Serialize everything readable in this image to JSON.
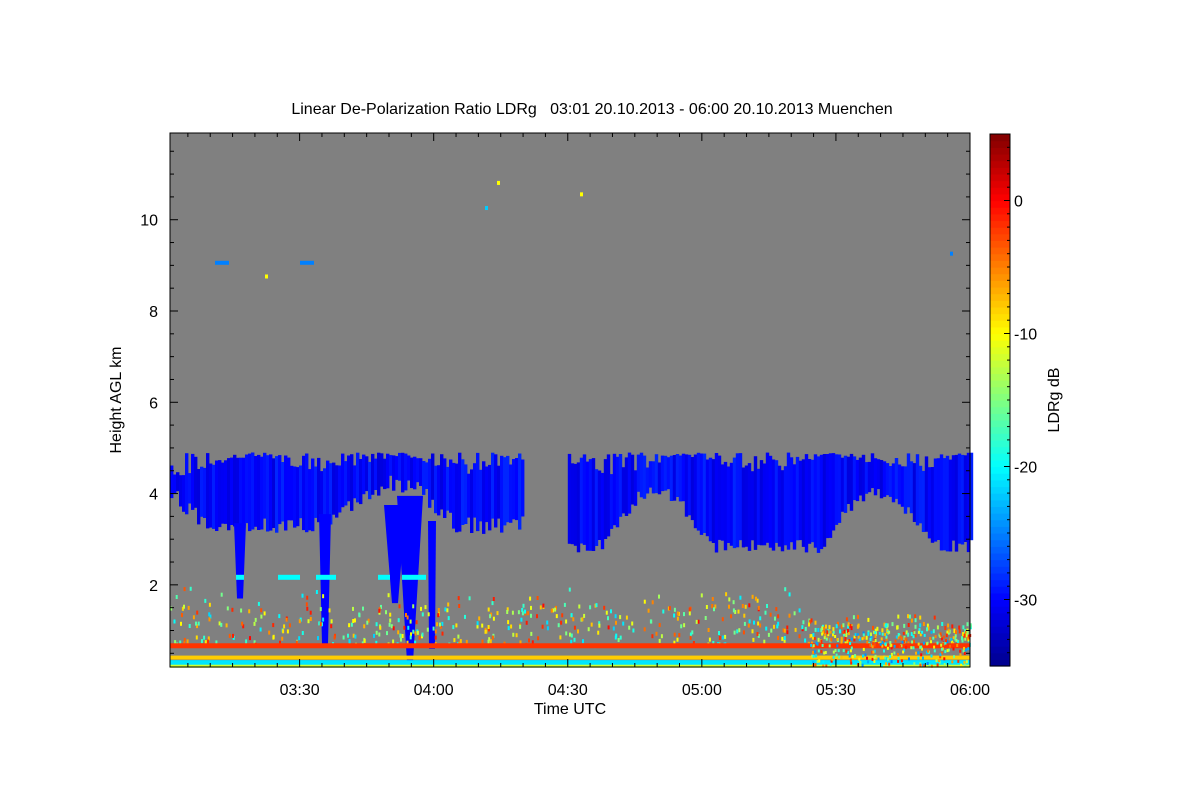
{
  "chart_data": {
    "type": "heatmap",
    "title": "Linear De-Polarization Ratio LDRg   03:01 20.10.2013 - 06:00 20.10.2013 Muenchen",
    "xlabel": "Time UTC",
    "ylabel": "Height AGL km",
    "x_range": [
      "03:01",
      "06:00"
    ],
    "x_ticks": [
      "03:30",
      "04:00",
      "04:30",
      "05:00",
      "05:30",
      "06:00"
    ],
    "y_range": [
      0.2,
      11.9
    ],
    "y_ticks": [
      2,
      4,
      6,
      8,
      10
    ],
    "colorbar": {
      "label": "LDRg dB",
      "range": [
        -35,
        5
      ],
      "ticks": [
        0,
        -10,
        -20,
        -30
      ],
      "colormap": "jet",
      "colors": [
        "#00008b",
        "#0000ff",
        "#0080ff",
        "#00ffff",
        "#80ff80",
        "#ffff00",
        "#ff8000",
        "#ff0000",
        "#800000"
      ]
    },
    "background_color": "#808080",
    "features": [
      {
        "name": "cloud layer",
        "time_start": "03:01",
        "time_end": "04:20",
        "base_km": 3.1,
        "top_km": 5.0,
        "ldr_db": -30
      },
      {
        "name": "cloud layer",
        "time_start": "04:30",
        "time_end": "06:00",
        "base_km": 2.7,
        "top_km": 5.0,
        "ldr_db": -30
      },
      {
        "name": "fall streaks",
        "time_start": "03:20",
        "time_end": "04:00",
        "base_km": 0.2,
        "top_km": 3.0,
        "ldr_db": -30
      },
      {
        "name": "near-surface layer",
        "time_start": "03:01",
        "time_end": "06:00",
        "base_km": 0.2,
        "top_km": 0.7,
        "ldr_db": -8
      },
      {
        "name": "scattered echoes",
        "time_start": "03:01",
        "time_end": "06:00",
        "base_km": 0.7,
        "top_km": 1.6,
        "ldr_db": -10
      }
    ]
  }
}
